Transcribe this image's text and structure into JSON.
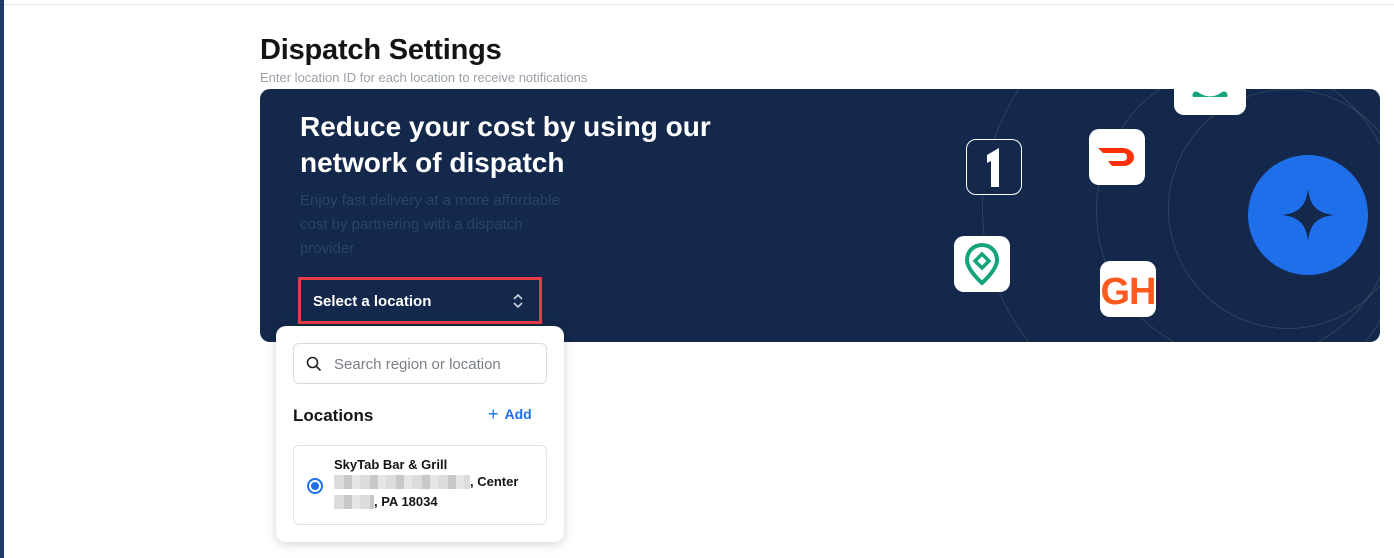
{
  "page": {
    "title": "Dispatch Settings",
    "subtitle": "Enter location ID for each location to receive notifications"
  },
  "banner": {
    "heading": "Reduce your cost by using our network of dispatch",
    "body": "Enjoy fast delivery at a more affordable cost by partnering with a dispatch provider",
    "provider_logos": [
      "one-logo-icon",
      "doordash-logo-icon",
      "green-provider-logo-icon",
      "location-pin-logo-icon",
      "grubhub-logo-icon",
      "sparkle-star-icon"
    ],
    "gh_text": "GH",
    "colors": {
      "background": "#13284a",
      "accent_blue": "#1f6fea",
      "doordash_red": "#ff3008",
      "grubhub_orange": "#ff5a1f",
      "green": "#15a37b"
    }
  },
  "location_select": {
    "label": "Select a location",
    "highlight_color": "#e43d45"
  },
  "dropdown": {
    "search_placeholder": "Search region or location",
    "section_title": "Locations",
    "add_label": "Add",
    "locations": [
      {
        "name": "SkyTab Bar & Grill",
        "address_line_2_suffix": ", Center",
        "address_line_3_suffix": ", PA 18034",
        "selected": true
      }
    ]
  }
}
